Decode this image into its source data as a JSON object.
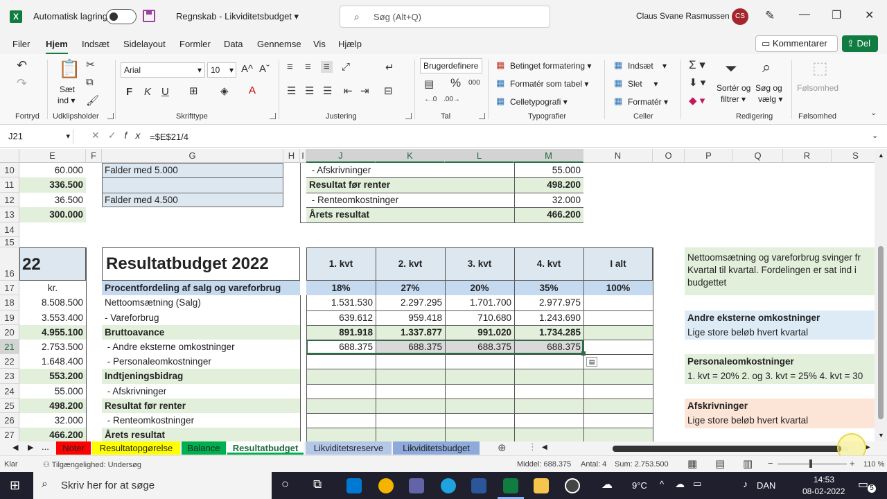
{
  "titlebar": {
    "autosave_label": "Automatisk lagring",
    "doc_title": "Regnskab - Likviditetsbudget",
    "search_placeholder": "Søg (Alt+Q)",
    "user_name": "Claus Svane Rasmussen",
    "avatar_initials": "CS",
    "brand_color": "#107c41"
  },
  "menubar": {
    "items": [
      "Filer",
      "Hjem",
      "Indsæt",
      "Sidelayout",
      "Formler",
      "Data",
      "Gennemse",
      "Vis",
      "Hjælp"
    ],
    "active": "Hjem",
    "comment_label": "Kommentarer",
    "share_label": "Del"
  },
  "ribbon": {
    "groups": [
      "Fortryd",
      "Udklipsholder",
      "Skrifttype",
      "Justering",
      "Tal",
      "Typografier",
      "Celler",
      "Redigering",
      "Følsomhed"
    ],
    "paste_label": "Sæt",
    "paste_label2": "ind",
    "font_name": "Arial",
    "font_size": "10",
    "number_format": "Brugerdefinere",
    "cond_format": "Betinget formatering",
    "format_table": "Formatér som tabel",
    "cell_styles": "Celletypografi",
    "insert": "Indsæt",
    "delete": "Slet",
    "format": "Formatér",
    "sort_filter": "Sortér og",
    "sort_filter2": "filtrer",
    "find_select": "Søg og",
    "find_select2": "vælg",
    "sensitivity": "Følsomhed"
  },
  "formula_bar": {
    "name_box": "J21",
    "formula": "=$E$21/4"
  },
  "columns": [
    "E",
    "F",
    "G",
    "H",
    "I",
    "J",
    "K",
    "L",
    "M",
    "N",
    "O",
    "P",
    "Q",
    "R",
    "S"
  ],
  "rows": [
    "10",
    "11",
    "12",
    "13",
    "14",
    "15",
    "16",
    "17",
    "18",
    "19",
    "20",
    "21",
    "22",
    "23",
    "24",
    "25",
    "26",
    "27"
  ],
  "cells": {
    "e10": "60.000",
    "e11": "336.500",
    "e12": "36.500",
    "e13": "300.000",
    "g10": "Falder med 5.000",
    "g12": "Falder med 4.500",
    "j10": " - Afskrivninger",
    "m10": "55.000",
    "j11": "Resultat før renter",
    "m11": "498.200",
    "j12": " - Renteomkostninger",
    "m12": "32.000",
    "j13": "Årets resultat",
    "m13": "466.200",
    "e16": "22",
    "g16": "Resultatbudget 2022",
    "j16": "1. kvt",
    "k16": "2. kvt",
    "l16": "3. kvt",
    "m16": "4. kvt",
    "n16": "I alt",
    "e17": "kr.",
    "g17": "Procentfordeling af salg og vareforbrug",
    "j17": "18%",
    "k17": "27%",
    "l17": "20%",
    "m17": "35%",
    "n17": "100%",
    "e18": "8.508.500",
    "g18": "Nettoomsætning (Salg)",
    "j18": "1.531.530",
    "k18": "2.297.295",
    "l18": "1.701.700",
    "m18": "2.977.975",
    "e19": "3.553.400",
    "g19": "- Vareforbrug",
    "j19": "639.612",
    "k19": "959.418",
    "l19": "710.680",
    "m19": "1.243.690",
    "e20": "4.955.100",
    "g20": "Bruttoavance",
    "j20": "891.918",
    "k20": "1.337.877",
    "l20": "991.020",
    "m20": "1.734.285",
    "e21": "2.753.500",
    "g21": " - Andre eksterne omkostninger",
    "j21": "688.375",
    "k21": "688.375",
    "l21": "688.375",
    "m21": "688.375",
    "e22": "1.648.400",
    "g22": " - Personaleomkostninger",
    "e23": "553.200",
    "g23": "Indtjeningsbidrag",
    "e24": "55.000",
    "g24": " - Afskrivninger",
    "e25": "498.200",
    "g25": "Resultat før renter",
    "e26": "32.000",
    "g26": " - Renteomkostninger",
    "e27": "466.200",
    "g27": "Årets resultat"
  },
  "notes": {
    "n1_line1": "Nettoomsætning og vareforbrug svinger fr",
    "n1_line2": "Kvartal til kvartal. Fordelingen er sat ind i",
    "n1_line3": "budgettet",
    "n2_title": "Andre eksterne omkostninger",
    "n2_text": "Lige store beløb hvert kvartal",
    "n3_title": "Personaleomkostninger",
    "n3_text": "1. kvt = 20% 2. og 3. kvt = 25% 4. kvt = 30",
    "n4_title": "Afskrivninger",
    "n4_text": "Lige store beløb hvert kvartal"
  },
  "sheet_tabs": [
    {
      "name": "Noter",
      "color": "#ff0000"
    },
    {
      "name": "Resultatopgørelse",
      "color": "#ffff00"
    },
    {
      "name": "Balance",
      "color": "#00b050"
    },
    {
      "name": "Resultatbudget",
      "color": "#ffffff"
    },
    {
      "name": "Likviditetsreserve",
      "color": "#8eaadb"
    },
    {
      "name": "Likviditetsbudget",
      "color": "#8eaadb"
    }
  ],
  "active_sheet": "Resultatbudget",
  "status": {
    "mode": "Klar",
    "accessibility": "Tilgængelighed: Undersøg",
    "average": "Middel: 688.375",
    "count": "Antal: 4",
    "sum": "Sum: 2.753.500",
    "zoom": "110 %"
  },
  "taskbar": {
    "search_placeholder": "Skriv her for at søge",
    "weather": "9°C",
    "language": "DAN",
    "time": "14:53",
    "date": "08-02-2022",
    "notifications": "5"
  }
}
